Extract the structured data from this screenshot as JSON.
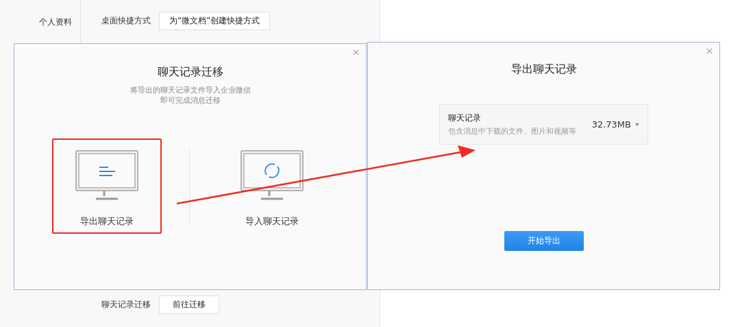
{
  "settings": {
    "section_label": "个人资料",
    "rows": [
      {
        "label": "桌面快捷方式",
        "buttons": [
          "为“微文档”创建快捷方式"
        ]
      },
      {
        "label": "聊天记录迁移",
        "buttons": [
          "前往迁移"
        ]
      }
    ]
  },
  "migration_dialog": {
    "title": "聊天记录迁移",
    "subtitle": [
      "将导出的聊天记录文件导入企业微信",
      "即可完成消息迁移"
    ],
    "options": [
      {
        "kind": "export",
        "label": "导出聊天记录",
        "highlighted": true
      },
      {
        "kind": "import",
        "label": "导入聊天记录",
        "highlighted": false
      }
    ]
  },
  "export_dialog": {
    "title": "导出聊天记录",
    "item": {
      "title": "聊天记录",
      "description": "包含消息中下载的文件、图片和视频等",
      "size": "32.73MB"
    },
    "button": "开始导出"
  }
}
